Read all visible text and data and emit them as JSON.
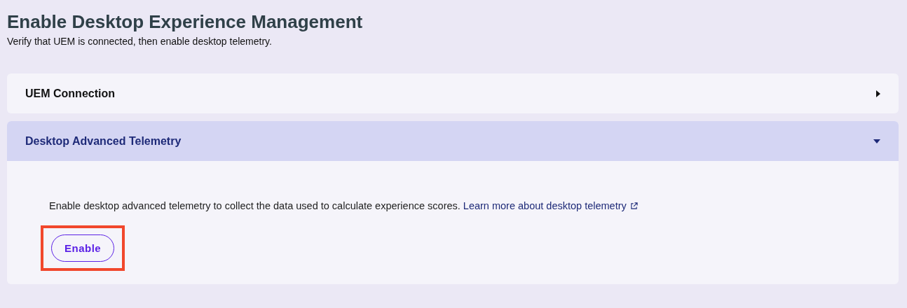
{
  "header": {
    "title": "Enable Desktop Experience Management",
    "subtitle": "Verify that UEM is connected, then enable desktop telemetry."
  },
  "sections": [
    {
      "title": "UEM Connection",
      "expanded": false
    },
    {
      "title": "Desktop Advanced Telemetry",
      "expanded": true,
      "description": "Enable desktop advanced telemetry to collect the data used to calculate experience scores.",
      "link": "Learn more about desktop telemetry",
      "button": {
        "label": "Enable",
        "highlighted": true
      }
    }
  ]
}
